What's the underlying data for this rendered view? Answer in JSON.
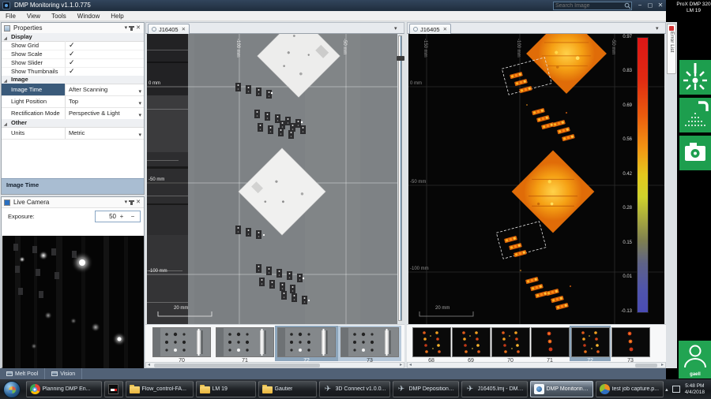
{
  "colors": {
    "accent_green": "#1d9e4e",
    "selection_blue": "#3a5a7a",
    "thumb_selection": "#8da6bc",
    "titlebar": "#243240"
  },
  "icons": {
    "check": "✓",
    "dropdown": "▾",
    "close": "✕",
    "minimize": "−",
    "maximize": "◻",
    "plus": "+",
    "minus": "−",
    "left_arrow": "◂",
    "right_arrow": "▸",
    "tray_arrow": "▴"
  },
  "titlebar": {
    "title": "DMP Monitoring v1.1.0.775",
    "search_placeholder": "Search Image"
  },
  "menubar": {
    "items": [
      "File",
      "View",
      "Tools",
      "Window",
      "Help"
    ]
  },
  "properties": {
    "title": "Properties",
    "display_section": "Display",
    "checkboxes": [
      "Show Grid",
      "Show Scale",
      "Show Slider",
      "Show Thumbnails"
    ],
    "image_section": "Image",
    "image_rows": [
      {
        "label": "Image Time",
        "value": "After Scanning"
      },
      {
        "label": "Light Position",
        "value": "Top"
      },
      {
        "label": "Rectification Mode",
        "value": "Perspective & Light"
      }
    ],
    "other_section": "Other",
    "units_row": {
      "label": "Units",
      "value": "Metric"
    },
    "status": "Image Time"
  },
  "live_camera": {
    "title": "Live Camera",
    "exposure_label": "Exposure:",
    "exposure_value": "50"
  },
  "center_view": {
    "tab": "J16405",
    "axis": {
      "h": [
        "0 mm",
        "-50 mm",
        "-100 mm"
      ],
      "v": [
        "-100 mm",
        "-50 mm"
      ],
      "scale": "20 mm"
    },
    "thumbnails": [
      "70",
      "71",
      "72",
      "73"
    ]
  },
  "right_view": {
    "tab": "J16405",
    "axis": {
      "h": [
        "0 mm",
        "-50 mm",
        "-100 mm"
      ],
      "v": [
        "-150 mm",
        "-100 mm",
        "-50 mm"
      ],
      "scale": "20 mm"
    },
    "colorbar_ticks": [
      "0.97",
      "0.83",
      "0.69",
      "0.56",
      "0.42",
      "0.28",
      "0.15",
      "0.01",
      "-0.13"
    ],
    "thumbnails": [
      "68",
      "69",
      "70",
      "71",
      "72",
      "73"
    ]
  },
  "error_list": {
    "label": "Error List"
  },
  "machine": {
    "line1": "ProX DMP 320",
    "line2": "LM 19",
    "user": "gaell"
  },
  "dock_tabs": {
    "items": [
      "Melt Pool",
      "Vision"
    ]
  },
  "taskbar": {
    "items": [
      "Planning DMP En...",
      "",
      "Flow_control-FA...",
      "LM 19",
      "Gautier",
      "3D Connect v1.0.0...",
      "DMP Deposition -...",
      "J16405.lmj - DMP ...",
      "DMP Monitoring ...",
      "test job capture.p..."
    ],
    "clock": {
      "time": "5:48 PM",
      "date": "4/4/2018"
    }
  }
}
